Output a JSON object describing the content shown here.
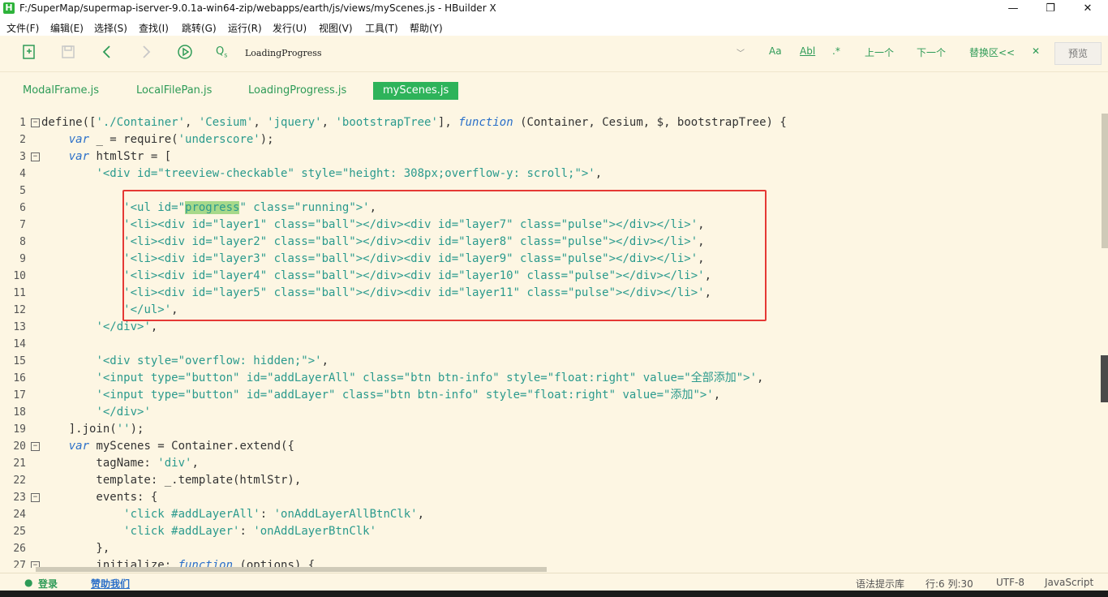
{
  "window": {
    "title": "F:/SuperMap/supermap-iserver-9.0.1a-win64-zip/webapps/earth/js/views/myScenes.js - HBuilder X",
    "app_icon_letter": "H",
    "minimize": "—",
    "maximize": "❐",
    "close": "✕"
  },
  "menu": [
    "文件(F)",
    "编辑(E)",
    "选择(S)",
    "查找(I)",
    "跳转(G)",
    "运行(R)",
    "发行(U)",
    "视图(V)",
    "工具(T)",
    "帮助(Y)"
  ],
  "toolbar": {
    "search_value": "LoadingProgress",
    "case_label": "Aa",
    "word_label": "Abl",
    "regex_label": ".*",
    "prev_label": "上一个",
    "next_label": "下一个",
    "replace_label": "替换区<<",
    "close_label": "✕",
    "preview_label": "预览"
  },
  "tabs": [
    "ModalFrame.js",
    "LocalFilePan.js",
    "LoadingProgress.js",
    "myScenes.js"
  ],
  "active_tab": 3,
  "status": {
    "login": "登录",
    "sponsor": "赞助我们",
    "hint_lib": "语法提示库",
    "position": "行:6  列:30",
    "encoding": "UTF-8",
    "language": "JavaScript"
  },
  "colors": {
    "accent": "#2eb35a",
    "editor_bg": "#fdf6e3",
    "keyword": "#2a6fc9",
    "string": "#2a9a8d",
    "highlight": "#a7d98a",
    "annotation_box": "#e53935"
  },
  "code_lines": [
    {
      "n": "1",
      "fold": "−",
      "segs": [
        [
          "p",
          "define(["
        ],
        [
          "s",
          "'./Container'"
        ],
        [
          "p",
          ", "
        ],
        [
          "s",
          "'Cesium'"
        ],
        [
          "p",
          ", "
        ],
        [
          "s",
          "'jquery'"
        ],
        [
          "p",
          ", "
        ],
        [
          "s",
          "'bootstrapTree'"
        ],
        [
          "p",
          "], "
        ],
        [
          "k",
          "function"
        ],
        [
          "p",
          " (Container, Cesium, $, bootstrapTree) {"
        ]
      ]
    },
    {
      "n": "2",
      "fold": "",
      "segs": [
        [
          "p",
          "    "
        ],
        [
          "k",
          "var"
        ],
        [
          "p",
          " _ = require("
        ],
        [
          "s",
          "'underscore'"
        ],
        [
          "p",
          ");"
        ]
      ]
    },
    {
      "n": "3",
      "fold": "−",
      "segs": [
        [
          "p",
          "    "
        ],
        [
          "k",
          "var"
        ],
        [
          "p",
          " htmlStr = ["
        ]
      ]
    },
    {
      "n": "4",
      "fold": "",
      "segs": [
        [
          "p",
          "        "
        ],
        [
          "s",
          "'<div id=\"treeview-checkable\" style=\"height: 308px;overflow-y: scroll;\">'"
        ],
        [
          "p",
          ","
        ]
      ]
    },
    {
      "n": "5",
      "fold": "",
      "segs": []
    },
    {
      "n": "6",
      "fold": "",
      "segs": [
        [
          "p",
          "            "
        ],
        [
          "s",
          "'<ul id=\""
        ],
        [
          "h",
          "progress"
        ],
        [
          "s",
          "\" class=\"running\">'"
        ],
        [
          "p",
          ","
        ]
      ]
    },
    {
      "n": "7",
      "fold": "",
      "segs": [
        [
          "p",
          "            "
        ],
        [
          "s",
          "'<li><div id=\"layer1\" class=\"ball\"></div><div id=\"layer7\" class=\"pulse\"></div></li>'"
        ],
        [
          "p",
          ","
        ]
      ]
    },
    {
      "n": "8",
      "fold": "",
      "segs": [
        [
          "p",
          "            "
        ],
        [
          "s",
          "'<li><div id=\"layer2\" class=\"ball\"></div><div id=\"layer8\" class=\"pulse\"></div></li>'"
        ],
        [
          "p",
          ","
        ]
      ]
    },
    {
      "n": "9",
      "fold": "",
      "segs": [
        [
          "p",
          "            "
        ],
        [
          "s",
          "'<li><div id=\"layer3\" class=\"ball\"></div><div id=\"layer9\" class=\"pulse\"></div></li>'"
        ],
        [
          "p",
          ","
        ]
      ]
    },
    {
      "n": "10",
      "fold": "",
      "segs": [
        [
          "p",
          "            "
        ],
        [
          "s",
          "'<li><div id=\"layer4\" class=\"ball\"></div><div id=\"layer10\" class=\"pulse\"></div></li>'"
        ],
        [
          "p",
          ","
        ]
      ]
    },
    {
      "n": "11",
      "fold": "",
      "segs": [
        [
          "p",
          "            "
        ],
        [
          "s",
          "'<li><div id=\"layer5\" class=\"ball\"></div><div id=\"layer11\" class=\"pulse\"></div></li>'"
        ],
        [
          "p",
          ","
        ]
      ]
    },
    {
      "n": "12",
      "fold": "",
      "segs": [
        [
          "p",
          "            "
        ],
        [
          "s",
          "'</ul>'"
        ],
        [
          "p",
          ","
        ]
      ]
    },
    {
      "n": "13",
      "fold": "",
      "segs": [
        [
          "p",
          "        "
        ],
        [
          "s",
          "'</div>'"
        ],
        [
          "p",
          ","
        ]
      ]
    },
    {
      "n": "14",
      "fold": "",
      "segs": []
    },
    {
      "n": "15",
      "fold": "",
      "segs": [
        [
          "p",
          "        "
        ],
        [
          "s",
          "'<div style=\"overflow: hidden;\">'"
        ],
        [
          "p",
          ","
        ]
      ]
    },
    {
      "n": "16",
      "fold": "",
      "segs": [
        [
          "p",
          "        "
        ],
        [
          "s",
          "'<input type=\"button\" id=\"addLayerAll\" class=\"btn btn-info\" style=\"float:right\" value=\"全部添加\">'"
        ],
        [
          "p",
          ","
        ]
      ]
    },
    {
      "n": "17",
      "fold": "",
      "segs": [
        [
          "p",
          "        "
        ],
        [
          "s",
          "'<input type=\"button\" id=\"addLayer\" class=\"btn btn-info\" style=\"float:right\" value=\"添加\">'"
        ],
        [
          "p",
          ","
        ]
      ]
    },
    {
      "n": "18",
      "fold": "",
      "segs": [
        [
          "p",
          "        "
        ],
        [
          "s",
          "'</div>'"
        ]
      ]
    },
    {
      "n": "19",
      "fold": "",
      "segs": [
        [
          "p",
          "    ].join("
        ],
        [
          "s",
          "''"
        ],
        [
          "p",
          ");"
        ]
      ]
    },
    {
      "n": "20",
      "fold": "−",
      "segs": [
        [
          "p",
          "    "
        ],
        [
          "k",
          "var"
        ],
        [
          "p",
          " myScenes = Container.extend({"
        ]
      ]
    },
    {
      "n": "21",
      "fold": "",
      "segs": [
        [
          "p",
          "        tagName: "
        ],
        [
          "s",
          "'div'"
        ],
        [
          "p",
          ","
        ]
      ]
    },
    {
      "n": "22",
      "fold": "",
      "segs": [
        [
          "p",
          "        template: _.template(htmlStr),"
        ]
      ]
    },
    {
      "n": "23",
      "fold": "−",
      "segs": [
        [
          "p",
          "        events: {"
        ]
      ]
    },
    {
      "n": "24",
      "fold": "",
      "segs": [
        [
          "p",
          "            "
        ],
        [
          "s",
          "'click #addLayerAll'"
        ],
        [
          "p",
          ": "
        ],
        [
          "s",
          "'onAddLayerAllBtnClk'"
        ],
        [
          "p",
          ","
        ]
      ]
    },
    {
      "n": "25",
      "fold": "",
      "segs": [
        [
          "p",
          "            "
        ],
        [
          "s",
          "'click #addLayer'"
        ],
        [
          "p",
          ": "
        ],
        [
          "s",
          "'onAddLayerBtnClk'"
        ]
      ]
    },
    {
      "n": "26",
      "fold": "",
      "segs": [
        [
          "p",
          "        },"
        ]
      ]
    },
    {
      "n": "27",
      "fold": "−",
      "segs": [
        [
          "p",
          "        initialize: "
        ],
        [
          "k",
          "function"
        ],
        [
          "p",
          " (options) {"
        ]
      ]
    }
  ]
}
